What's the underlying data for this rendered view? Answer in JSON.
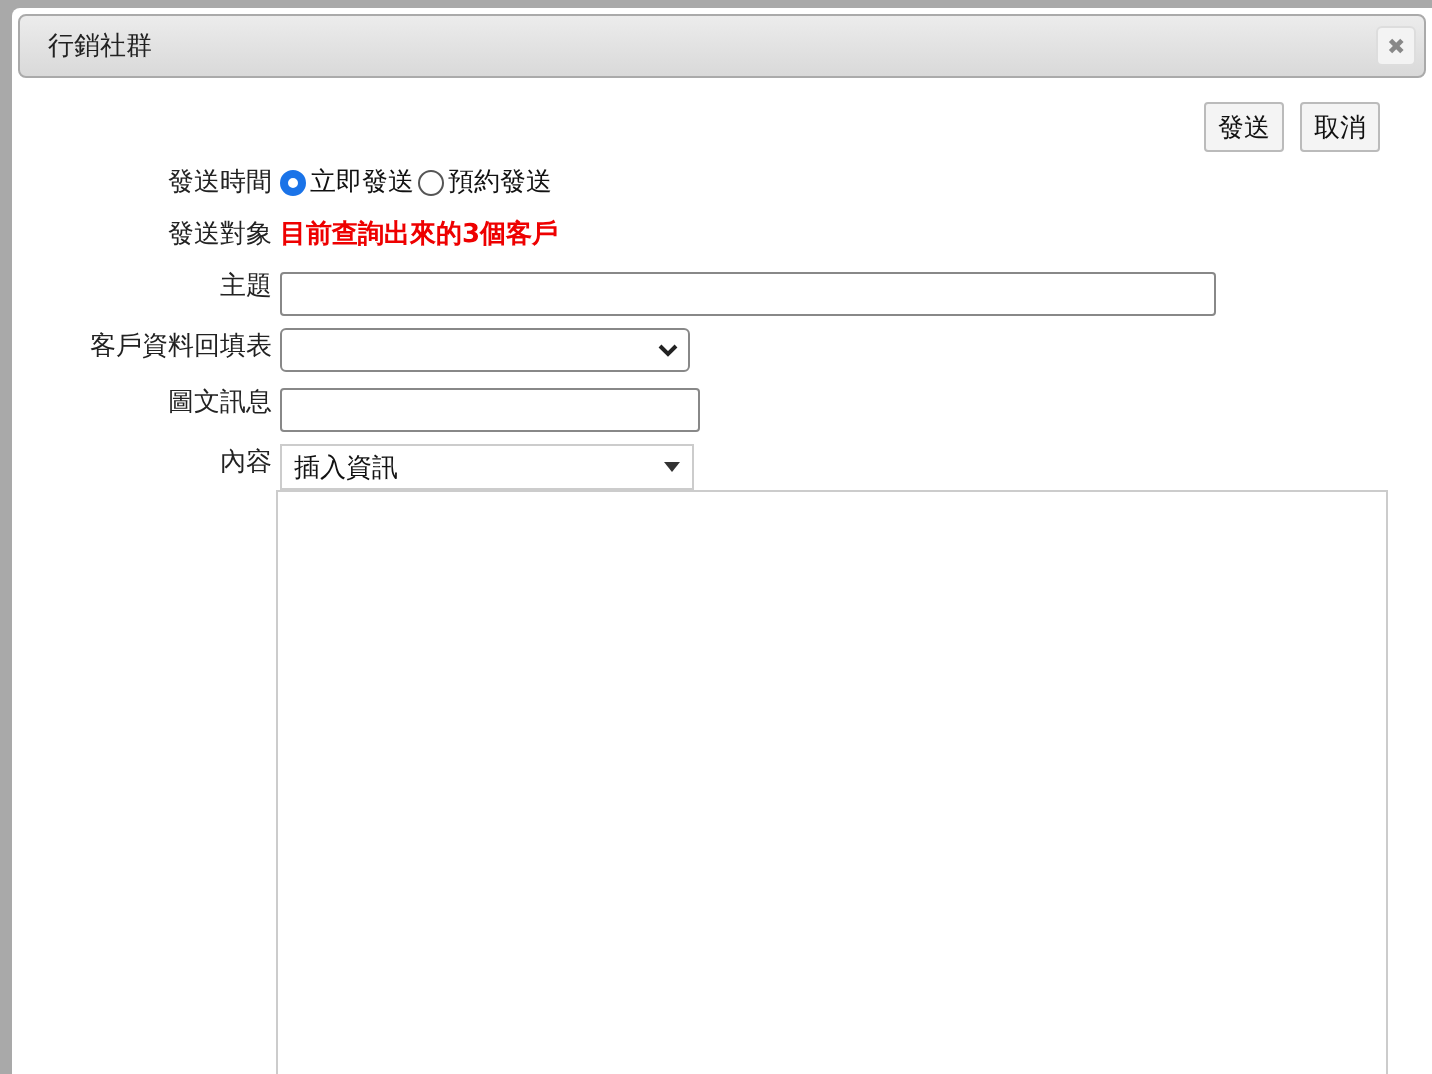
{
  "dialog": {
    "title": "行銷社群",
    "close": "✖"
  },
  "actions": [
    "發送",
    "取消"
  ],
  "send_time": {
    "label": "發送時間",
    "options": [
      {
        "label": "立即發送",
        "selected": true
      },
      {
        "label": "預約發送",
        "selected": false
      }
    ]
  },
  "target": {
    "label": "發送對象",
    "value": "目前查詢出來的3個客戶"
  },
  "fields": [
    {
      "kind": "text",
      "label": "主題"
    },
    {
      "kind": "select",
      "label": "客戶資料回填表"
    },
    {
      "kind": "short",
      "label": "圖文訊息"
    },
    {
      "kind": "menu",
      "label": "內容",
      "value": "插入資訊"
    }
  ]
}
